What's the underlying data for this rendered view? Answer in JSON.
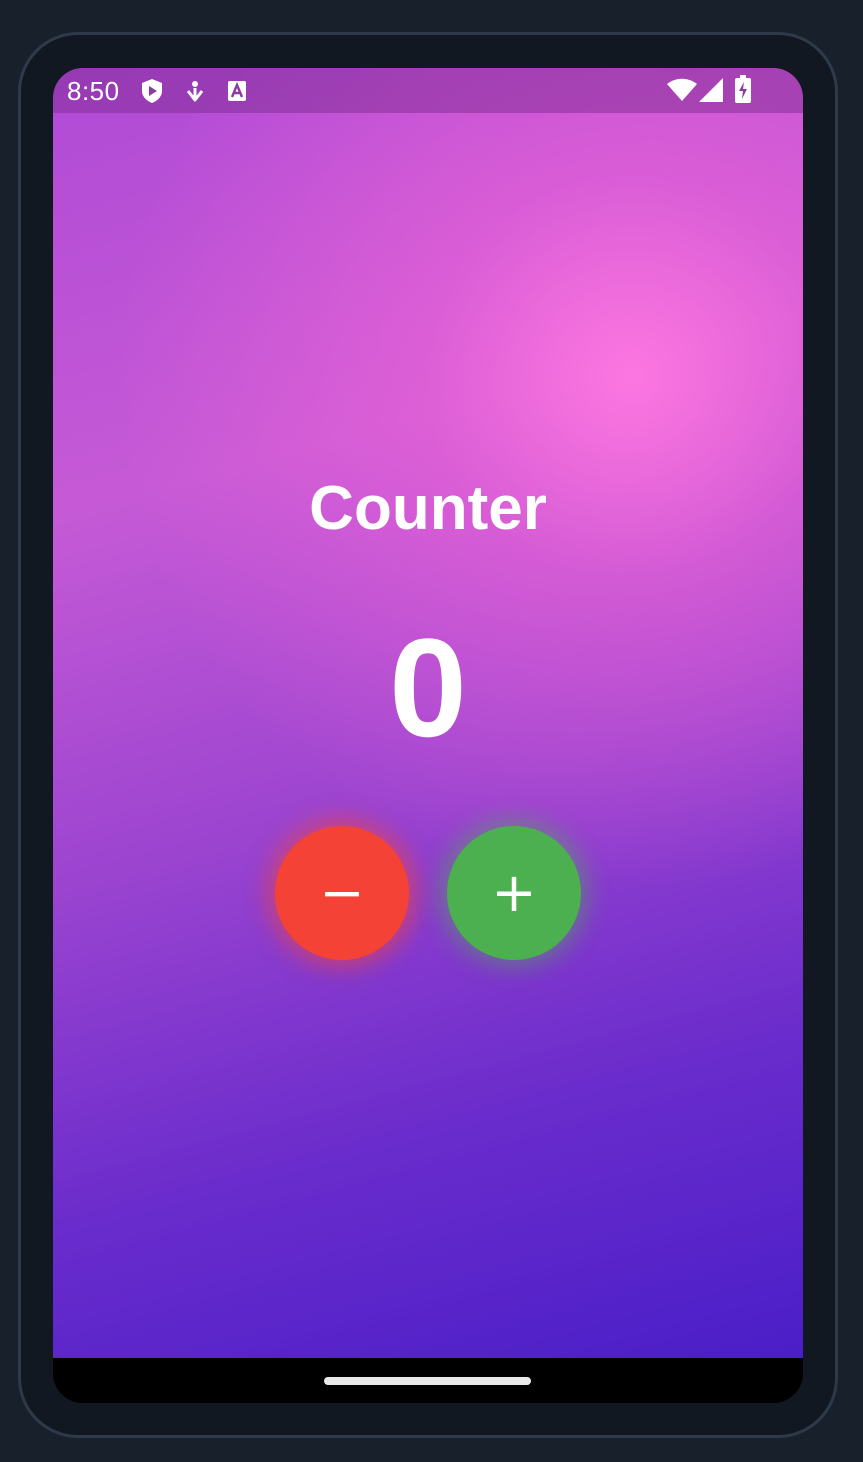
{
  "status_bar": {
    "time": "8:50",
    "left_icons": [
      "shield-play-icon",
      "download-arrow-icon",
      "text-a-icon"
    ],
    "right_icons": [
      "wifi-icon",
      "cellular-signal-icon",
      "battery-charging-icon"
    ]
  },
  "app": {
    "title": "Counter",
    "count": "0",
    "decrement_label": "−",
    "increment_label": "+"
  },
  "colors": {
    "decrement": "#f44336",
    "increment": "#4caf50",
    "gradient_top": "#c65ad6",
    "gradient_bottom": "#4a1ec8",
    "highlight": "#ff78e1"
  }
}
